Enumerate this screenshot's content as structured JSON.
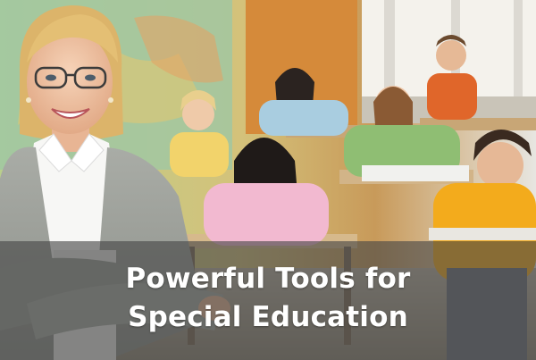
{
  "hero": {
    "headline_line1": "Powerful Tools for",
    "headline_line2": "Special Education"
  },
  "colors": {
    "overlay": "#464646",
    "text": "#ffffff"
  }
}
